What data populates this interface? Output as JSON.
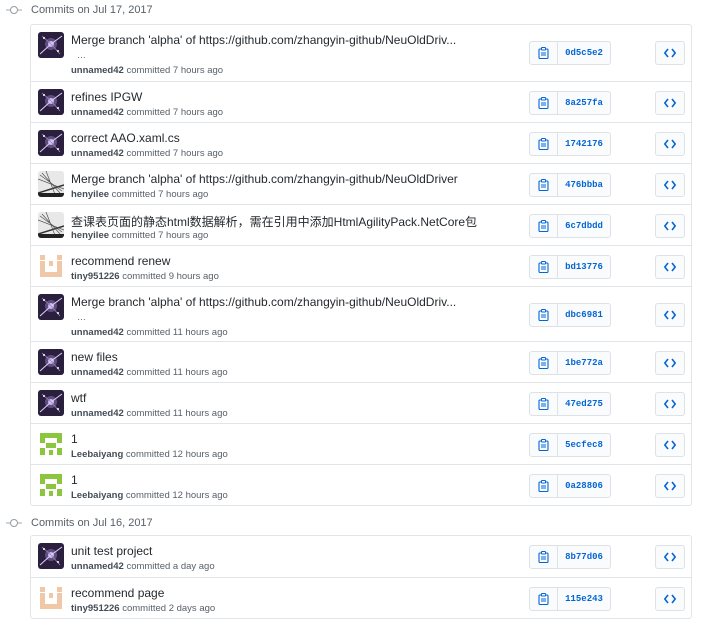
{
  "groups": [
    {
      "title": "Commits on Jul 17, 2017",
      "commits": [
        {
          "message": "Merge branch 'alpha' of https://github.com/zhangyin-github/NeuOldDriv...",
          "ellipsis": "…",
          "author": "unnamed42",
          "committed": "committed 7 hours ago",
          "sha": "0d5c5e2",
          "avatar": "galaxy-avatar"
        },
        {
          "message": "refines IPGW",
          "author": "unnamed42",
          "committed": "committed 7 hours ago",
          "sha": "8a257fa",
          "avatar": "galaxy-avatar"
        },
        {
          "message": "correct AAO.xaml.cs",
          "author": "unnamed42",
          "committed": "committed 7 hours ago",
          "sha": "1742176",
          "avatar": "galaxy-avatar"
        },
        {
          "message": "Merge branch 'alpha' of https://github.com/zhangyin-github/NeuOldDriver",
          "author": "henyilee",
          "committed": "committed 7 hours ago",
          "sha": "476bbba",
          "avatar": "bridge-avatar"
        },
        {
          "message": "查课表页面的静态html数据解析，需在引用中添加HtmlAgilityPack.NetCore包",
          "author": "henyilee",
          "committed": "committed 7 hours ago",
          "sha": "6c7dbdd",
          "avatar": "bridge-avatar"
        },
        {
          "message": "recommend renew",
          "author": "tiny951226",
          "committed": "committed 9 hours ago",
          "sha": "bd13776",
          "avatar": "identicon-orange-avatar"
        },
        {
          "message": "Merge branch 'alpha' of https://github.com/zhangyin-github/NeuOldDriv...",
          "ellipsis": "…",
          "author": "unnamed42",
          "committed": "committed 11 hours ago",
          "sha": "dbc6981",
          "avatar": "galaxy-avatar"
        },
        {
          "message": "new files",
          "author": "unnamed42",
          "committed": "committed 11 hours ago",
          "sha": "1be772a",
          "avatar": "galaxy-avatar"
        },
        {
          "message": "wtf",
          "author": "unnamed42",
          "committed": "committed 11 hours ago",
          "sha": "47ed275",
          "avatar": "galaxy-avatar"
        },
        {
          "message": "1",
          "author": "Leebaiyang",
          "committed": "committed 12 hours ago",
          "sha": "5ecfec8",
          "avatar": "identicon-green-avatar"
        },
        {
          "message": "1",
          "author": "Leebaiyang",
          "committed": "committed 12 hours ago",
          "sha": "0a28806",
          "avatar": "identicon-green-avatar"
        }
      ]
    },
    {
      "title": "Commits on Jul 16, 2017",
      "commits": [
        {
          "message": "unit test project",
          "author": "unnamed42",
          "committed": "committed a day ago",
          "sha": "8b77d06",
          "avatar": "galaxy-avatar"
        },
        {
          "message": "recommend page",
          "author": "tiny951226",
          "committed": "committed 2 days ago",
          "sha": "115e243",
          "avatar": "identicon-orange-avatar"
        }
      ]
    }
  ],
  "icons": {
    "copy": "clipboard-icon",
    "browse": "code-icon",
    "timeline": "git-commit-icon"
  },
  "colors": {
    "sha_link": "#0366d6",
    "border": "#e1e4e8",
    "meta_text": "#586069",
    "identicon_green": "#8cc63f",
    "identicon_orange": "#f0c8a8"
  }
}
